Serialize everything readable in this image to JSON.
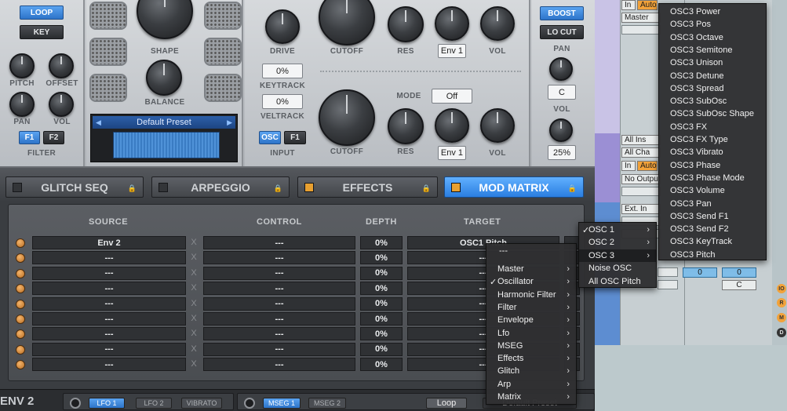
{
  "synth": {
    "filter_section": {
      "loop_label": "LOOP",
      "key_label": "KEY",
      "pitch_label": "PITCH",
      "offset_label": "OFFSET",
      "pan_label": "PAN",
      "vol_label": "VOL",
      "f1_label": "F1",
      "f2_label": "F2",
      "section_label": "FILTER"
    },
    "shape_section": {
      "shape_label": "SHAPE",
      "balance_label": "BALANCE",
      "preset_name": "Default Preset"
    },
    "drive_section": {
      "drive_label": "DRIVE",
      "keytrack_value": "0%",
      "keytrack_label": "KEYTRACK",
      "veltrack_value": "0%",
      "veltrack_label": "VELTRACK",
      "osc_label": "OSC",
      "f1_label": "F1",
      "input_label": "INPUT"
    },
    "filter1": {
      "cutoff_label": "CUTOFF",
      "res_label": "RES",
      "env_value": "Env 1",
      "vol_label": "VOL"
    },
    "filter2": {
      "mode_label": "MODE",
      "mode_value": "Off",
      "cutoff_label": "CUTOFF",
      "res_label": "RES",
      "env_value": "Env 1",
      "vol_label": "VOL"
    },
    "output": {
      "boost_label": "BOOST",
      "locut_label": "LO CUT",
      "pan_label": "PAN",
      "pan_value": "C",
      "vol_label": "VOL",
      "vol_value": "25%"
    }
  },
  "tabs": [
    {
      "label": "GLITCH SEQ",
      "active": false
    },
    {
      "label": "ARPEGGIO",
      "active": false
    },
    {
      "label": "EFFECTS",
      "active": false
    },
    {
      "label": "MOD MATRIX",
      "active": true
    }
  ],
  "matrix": {
    "headers": {
      "source": "SOURCE",
      "control": "CONTROL",
      "depth": "DEPTH",
      "target": "TARGET"
    },
    "x_symbol": "X",
    "rows": [
      {
        "source": "Env 2",
        "control": "---",
        "depth": "0%",
        "target": "OSC1 Pitch"
      },
      {
        "source": "---",
        "control": "---",
        "depth": "0%",
        "target": "---"
      },
      {
        "source": "---",
        "control": "---",
        "depth": "0%",
        "target": "---"
      },
      {
        "source": "---",
        "control": "---",
        "depth": "0%",
        "target": "---"
      },
      {
        "source": "---",
        "control": "---",
        "depth": "0%",
        "target": "---"
      },
      {
        "source": "---",
        "control": "---",
        "depth": "0%",
        "target": "---"
      },
      {
        "source": "---",
        "control": "---",
        "depth": "0%",
        "target": "---"
      },
      {
        "source": "---",
        "control": "---",
        "depth": "0%",
        "target": "---"
      },
      {
        "source": "---",
        "control": "---",
        "depth": "0%",
        "target": "---"
      }
    ]
  },
  "bottom": {
    "env_label": "ENV 2",
    "lfo1": "LFO 1",
    "lfo2": "LFO 2",
    "vibrato": "VIBRATO",
    "mseg1": "MSEG 1",
    "mseg2": "MSEG 2",
    "loop": "Loop",
    "preset": "Default Preset"
  },
  "daw": {
    "in1": "In",
    "auto1": "Auto",
    "master": "Master",
    "all_ins": "All Ins",
    "all_cha": "All Cha",
    "in2": "In",
    "auto2": "Auto",
    "no_output": "No Output",
    "ext_in": "Ext. In",
    "val_a": "0",
    "val_b": "0",
    "val_c": "C",
    "side_icons": [
      "IO",
      "R",
      "M",
      "D"
    ]
  },
  "menu_main": {
    "dashes": "---",
    "items": [
      "Master",
      "Oscillator",
      "Harmonic Filter",
      "Filter",
      "Envelope",
      "Lfo",
      "MSEG",
      "Effects",
      "Glitch",
      "Arp",
      "Matrix"
    ],
    "checked": "Oscillator"
  },
  "menu_osc": {
    "items": [
      "OSC 1",
      "OSC 2",
      "OSC 3",
      "Noise OSC",
      "All OSC Pitch"
    ],
    "checked": "OSC 1",
    "highlighted": "OSC 3"
  },
  "menu_osc3": {
    "items": [
      "OSC3 Power",
      "OSC3 Pos",
      "OSC3 Octave",
      "OSC3 Semitone",
      "OSC3 Unison",
      "OSC3 Detune",
      "OSC3 Spread",
      "OSC3 SubOsc",
      "OSC3 SubOsc Shape",
      "OSC3 FX",
      "OSC3 FX Type",
      "OSC3 Vibrato",
      "OSC3 Phase",
      "OSC3 Phase Mode",
      "OSC3 Volume",
      "OSC3 Pan",
      "OSC3 Send F1",
      "OSC3 Send F2",
      "OSC3 KeyTrack",
      "OSC3 Pitch"
    ]
  },
  "colors": {
    "accent": "#2d74c9",
    "orange": "#e8a030",
    "menu_bg": "#303032"
  }
}
